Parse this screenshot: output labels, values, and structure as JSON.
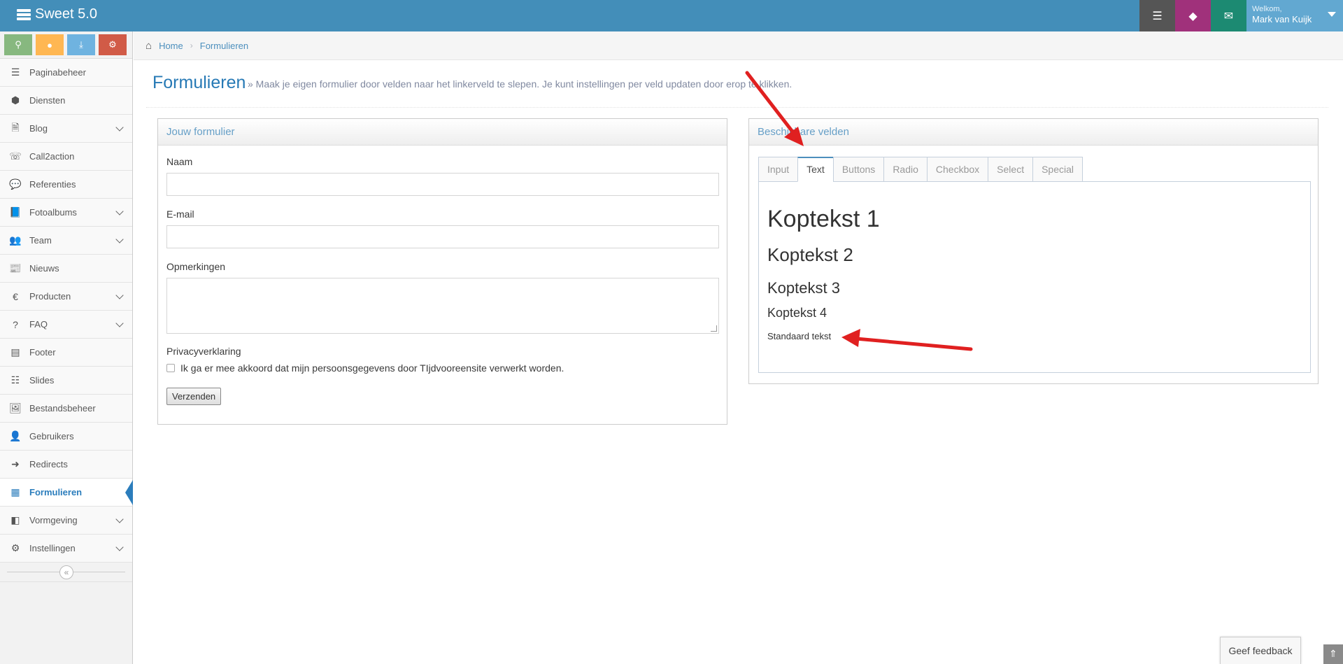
{
  "app": {
    "title": "Sweet 5.0"
  },
  "navbar": {
    "welcome": "Welkom,",
    "user_name": "Mark van Kuijk"
  },
  "sidebar": {
    "items": [
      {
        "label": "Paginabeheer",
        "icon": "menu-bars-icon",
        "glyph": "☰",
        "has_children": false
      },
      {
        "label": "Diensten",
        "icon": "cubes-icon",
        "glyph": "⬢",
        "has_children": false
      },
      {
        "label": "Blog",
        "icon": "file-text-icon",
        "glyph": "🗎",
        "has_children": true
      },
      {
        "label": "Call2action",
        "icon": "phone-icon",
        "glyph": "☏",
        "has_children": false
      },
      {
        "label": "Referenties",
        "icon": "comment-icon",
        "glyph": "💬",
        "has_children": false
      },
      {
        "label": "Fotoalbums",
        "icon": "book-icon",
        "glyph": "📘",
        "has_children": true
      },
      {
        "label": "Team",
        "icon": "users-icon",
        "glyph": "👥",
        "has_children": true
      },
      {
        "label": "Nieuws",
        "icon": "newspaper-icon",
        "glyph": "📰",
        "has_children": false
      },
      {
        "label": "Producten",
        "icon": "euro-icon",
        "glyph": "€",
        "has_children": true
      },
      {
        "label": "FAQ",
        "icon": "question-icon",
        "glyph": "?",
        "has_children": true
      },
      {
        "label": "Footer",
        "icon": "list-alt-icon",
        "glyph": "▤",
        "has_children": false
      },
      {
        "label": "Slides",
        "icon": "sliders-icon",
        "glyph": "☷",
        "has_children": false
      },
      {
        "label": "Bestandsbeheer",
        "icon": "image-icon",
        "glyph": "🖼",
        "has_children": false
      },
      {
        "label": "Gebruikers",
        "icon": "user-icon",
        "glyph": "👤",
        "has_children": false
      },
      {
        "label": "Redirects",
        "icon": "arrow-circle-icon",
        "glyph": "➜",
        "has_children": false
      },
      {
        "label": "Formulieren",
        "icon": "form-icon",
        "glyph": "▦",
        "has_children": false,
        "active": true
      },
      {
        "label": "Vormgeving",
        "icon": "columns-icon",
        "glyph": "◧",
        "has_children": true
      },
      {
        "label": "Instellingen",
        "icon": "gear-icon",
        "glyph": "⚙",
        "has_children": true
      }
    ]
  },
  "breadcrumb": {
    "home": "Home",
    "current": "Formulieren"
  },
  "page": {
    "title": "Formulieren",
    "subtitle": "» Maak je eigen formulier door velden naar het linkerveld te slepen. Je kunt instellingen per veld updaten door erop te klikken."
  },
  "form_panel": {
    "title": "Jouw formulier",
    "fields": {
      "name_label": "Naam",
      "email_label": "E-mail",
      "comments_label": "Opmerkingen",
      "privacy_label": "Privacyverklaring",
      "privacy_checkbox": "Ik ga er mee akkoord dat mijn persoonsgegevens door TIjdvooreensite verwerkt worden."
    },
    "submit_label": "Verzenden"
  },
  "fields_panel": {
    "title": "Beschikbare velden",
    "tabs": [
      "Input",
      "Text",
      "Buttons",
      "Radio",
      "Checkbox",
      "Select",
      "Special"
    ],
    "active_tab": "Text",
    "text_items": {
      "h1": "Koptekst 1",
      "h2": "Koptekst 2",
      "h3": "Koptekst 3",
      "h4": "Koptekst 4",
      "p": "Standaard tekst"
    }
  },
  "feedback_label": "Geef feedback",
  "colors": {
    "navbar": "#438eb9",
    "accent": "#2679b5",
    "arrow": "#e02020"
  }
}
